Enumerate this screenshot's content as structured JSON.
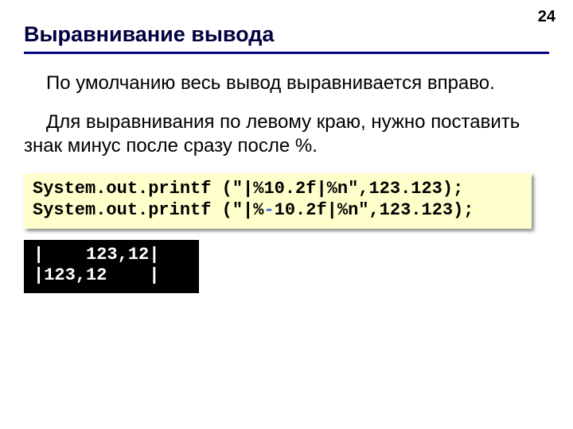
{
  "page_number": "24",
  "title": "Выравнивание вывода",
  "paragraphs": {
    "p1": "По умолчанию весь вывод выравнивается вправо.",
    "p2": "Для выравнивания по левому краю, нужно поставить знак минус после сразу после %."
  },
  "code": {
    "line1_a": "System.out.printf (\"|%10.2f|%n\",123.123);",
    "line2_a": "System.out.printf (\"|%",
    "line2_minus": "-",
    "line2_b": "10.2f|%n\",123.123);"
  },
  "output": {
    "line1": "|    123,12|",
    "line2": "|123,12    |"
  }
}
